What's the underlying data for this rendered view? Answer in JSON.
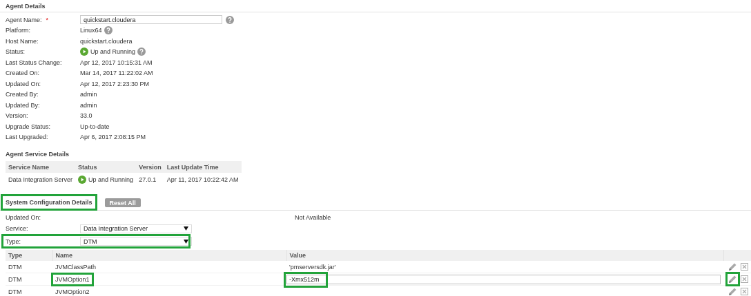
{
  "agent_details": {
    "title": "Agent Details",
    "fields": [
      {
        "label": "Agent Name:",
        "required_mark": "*",
        "kind": "field",
        "value": "quickstart.cloudera",
        "help": true
      },
      {
        "label": "Platform:",
        "kind": "text",
        "value": "Linux64",
        "help": true
      },
      {
        "label": "Host Name:",
        "kind": "text",
        "value": "quickstart.cloudera",
        "help": false
      },
      {
        "label": "Status:",
        "kind": "status",
        "value": "Up and Running",
        "help": true
      },
      {
        "label": "Last Status Change:",
        "kind": "text",
        "value": "Apr 12, 2017 10:15:31 AM",
        "help": false
      },
      {
        "label": "Created On:",
        "kind": "text",
        "value": "Mar 14, 2017 11:22:02 AM",
        "help": false
      },
      {
        "label": "Updated On:",
        "kind": "text",
        "value": "Apr 12, 2017 2:23:30 PM",
        "help": false
      },
      {
        "label": "Created By:",
        "kind": "text",
        "value": "admin",
        "help": false
      },
      {
        "label": "Updated By:",
        "kind": "text",
        "value": "admin",
        "help": false
      },
      {
        "label": "Version:",
        "kind": "text",
        "value": "33.0",
        "help": false
      },
      {
        "label": "Upgrade Status:",
        "kind": "text",
        "value": "Up-to-date",
        "help": false
      },
      {
        "label": "Last Upgraded:",
        "kind": "text",
        "value": "Apr 6, 2017 2:08:15 PM",
        "help": false
      }
    ]
  },
  "agent_service_details": {
    "title": "Agent Service Details",
    "columns": [
      "Service Name",
      "Status",
      "Version",
      "Last Update Time"
    ],
    "rows": [
      {
        "service_name": "Data Integration Server",
        "status": "Up and Running",
        "version": "27.0.1",
        "last_update_time": "Apr 11, 2017 10:22:42 AM"
      }
    ]
  },
  "system_configuration": {
    "title": "System Configuration Details",
    "highlighted": true,
    "reset_button": "Reset All",
    "updated_on": {
      "label": "Updated On:",
      "value": "Not Available"
    },
    "selects": [
      {
        "label": "Service:",
        "value": "Data Integration Server",
        "highlighted": false
      },
      {
        "label": "Type:",
        "value": "DTM",
        "highlighted": true
      }
    ],
    "table": {
      "columns": [
        "Type",
        "Name",
        "Value"
      ],
      "rows": [
        {
          "type": "DTM",
          "name": "JVMClassPath",
          "value": "'pmserversdk.jar'",
          "kind": "text",
          "name_highlighted": false,
          "value_highlighted": false,
          "edit_highlighted": false
        },
        {
          "type": "DTM",
          "name": "JVMOption1",
          "value": "-Xmx512m",
          "kind": "field",
          "name_highlighted": true,
          "value_highlighted": true,
          "edit_highlighted": true
        },
        {
          "type": "DTM",
          "name": "JVMOption2",
          "kind": "none",
          "name_highlighted": false,
          "value_highlighted": false,
          "edit_highlighted": false
        }
      ]
    }
  }
}
